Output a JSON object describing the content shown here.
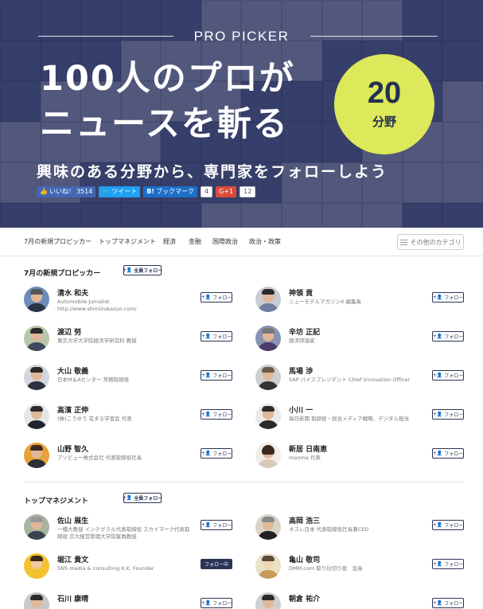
{
  "hero": {
    "brand": "PRO PICKER",
    "headline_1": "100人のプロが",
    "headline_2": "ニュースを斬る",
    "badge_number": "20",
    "badge_unit": "分野",
    "subhead": "興味のある分野から、専門家をフォローしよう",
    "social": {
      "like_label": "いいね！",
      "like_count": "3514",
      "tweet_label": "ツイート",
      "hatena_label": "ブックマーク",
      "hatena_count": "4",
      "gplus_label": "G+1",
      "gplus_count": "12"
    }
  },
  "nav": {
    "items": [
      "7月の新規プロピッカー",
      "トップマネジメント",
      "経済",
      "金融",
      "国際政治",
      "政治・政策"
    ],
    "other_label": "その他のカテゴリ"
  },
  "follow_all_label": "全員フォロー",
  "follow_label": "フォロー",
  "following_label": "フォロー中",
  "sections": [
    {
      "title": "7月の新規プロピッカー",
      "people": [
        {
          "name": "清水 和夫",
          "desc": "Automobile Jurnalist\nhttp://www.shimizukazuo.com/",
          "following": false
        },
        {
          "name": "神領 貢",
          "desc": "ニューモデルマガジンX 編集長",
          "following": false
        },
        {
          "name": "渡辺 努",
          "desc": "東京大学大学院経済学研究科 教授",
          "following": false
        },
        {
          "name": "辛坊 正記",
          "desc": "経済評論家",
          "following": false
        },
        {
          "name": "大山 敬義",
          "desc": "日本M＆Aセンター 常務取締役",
          "following": false
        },
        {
          "name": "馬場 渉",
          "desc": "SAP バイスプレジデント Chief Innovation Officer",
          "following": false
        },
        {
          "name": "高濱 正伸",
          "desc": "(株)こうゆう 花まる学習会 代表",
          "following": false
        },
        {
          "name": "小川 一",
          "desc": "毎日新聞 取締役・総合メディア戦略、デジタル担当",
          "following": false
        },
        {
          "name": "山野 智久",
          "desc": "アソビュー株式会社 代表取締役社長",
          "following": false
        },
        {
          "name": "新居 日南恵",
          "desc": "manma 代表",
          "following": false
        }
      ]
    },
    {
      "title": "トップマネジメント",
      "people": [
        {
          "name": "佐山 展生",
          "desc": "一橋大教授 インテグラル代表取締役 スカイマーク代表取締役 京大経営管理大学院客員教授",
          "following": false
        },
        {
          "name": "高岡 浩三",
          "desc": "ネスレ日本 代表取締役社長兼CEO",
          "following": false
        },
        {
          "name": "堀江 貴文",
          "desc": "SNS media & consulting K.K. Founder",
          "following": true
        },
        {
          "name": "亀山 敬司",
          "desc": "DMM.com 取り仕切り役　会長",
          "following": false
        },
        {
          "name": "石川 康晴",
          "desc": "",
          "following": false
        },
        {
          "name": "朝倉 祐介",
          "desc": "",
          "following": false
        }
      ]
    }
  ],
  "colors": {
    "hero_overlay": "#1e285f",
    "badge_bg": "#dde85a",
    "navy": "#2a3555"
  }
}
